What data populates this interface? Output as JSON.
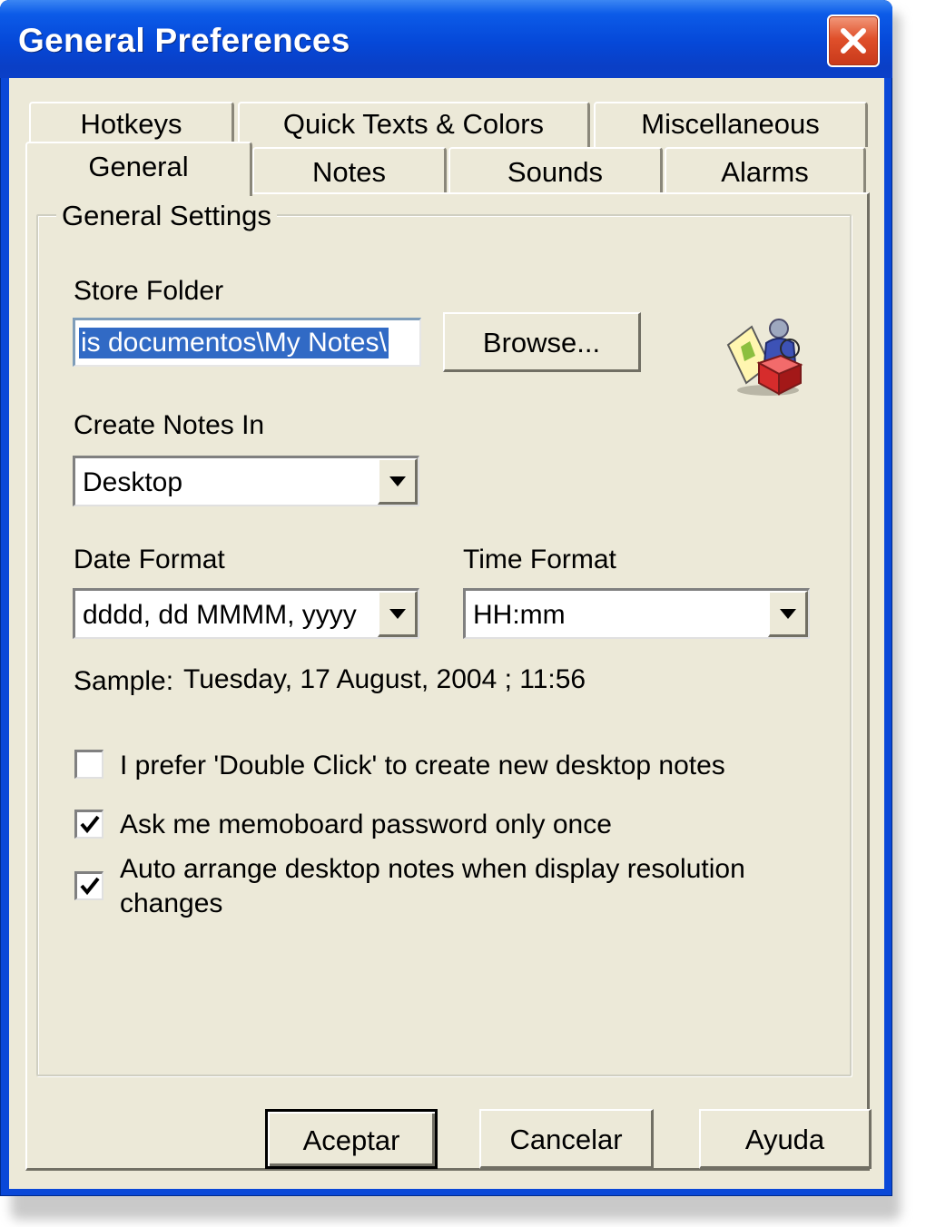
{
  "window": {
    "title": "General Preferences"
  },
  "tabs": {
    "row_back": [
      {
        "label": "Hotkeys"
      },
      {
        "label": "Quick Texts & Colors"
      },
      {
        "label": "Miscellaneous"
      }
    ],
    "row_front": [
      {
        "label": "General",
        "selected": true
      },
      {
        "label": "Notes"
      },
      {
        "label": "Sounds"
      },
      {
        "label": "Alarms"
      }
    ]
  },
  "general_settings": {
    "group_title": "General Settings",
    "store_folder": {
      "label": "Store Folder",
      "value": "is documentos\\My Notes\\",
      "browse_label": "Browse..."
    },
    "create_notes_in": {
      "label": "Create Notes In",
      "selected": "Desktop"
    },
    "date_format": {
      "label": "Date Format",
      "selected": "dddd, dd MMMM, yyyy"
    },
    "time_format": {
      "label": "Time Format",
      "selected": "HH:mm"
    },
    "sample": {
      "label": "Sample:",
      "value": "Tuesday, 17 August, 2004 ; 11:56"
    },
    "options": [
      {
        "label": "I prefer 'Double Click' to create new desktop notes",
        "checked": false
      },
      {
        "label": "Ask me memoboard password only once",
        "checked": true
      },
      {
        "label_line1": "Auto arrange desktop notes when display resolution",
        "label_line2": "changes",
        "checked": true
      }
    ],
    "icon": "app-notes-icon"
  },
  "footer": {
    "ok_label": "Aceptar",
    "cancel_label": "Cancelar",
    "help_label": "Ayuda"
  },
  "colors": {
    "titlebar": "#0548d8",
    "face": "#ece9d8",
    "selection": "#316ac5",
    "close": "#e0502b"
  }
}
